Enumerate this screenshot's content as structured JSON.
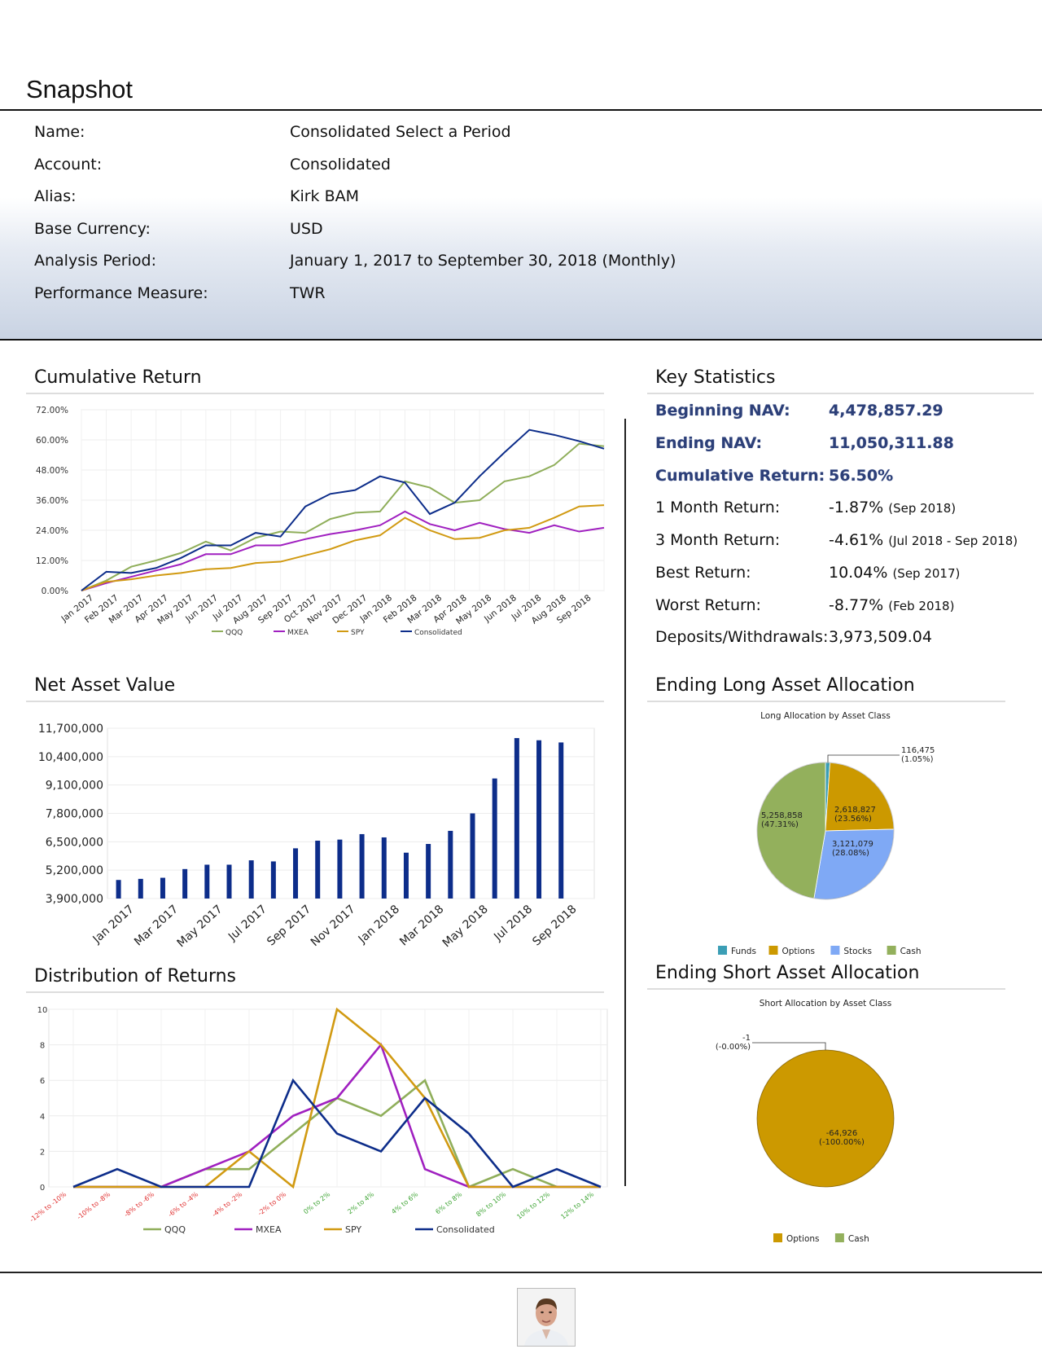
{
  "snapshot": {
    "title": "Snapshot",
    "rows": [
      {
        "label": "Name:",
        "value": "Consolidated Select a Period"
      },
      {
        "label": "Account:",
        "value": "Consolidated"
      },
      {
        "label": "Alias:",
        "value": "Kirk BAM"
      },
      {
        "label": "Base Currency:",
        "value": "USD"
      },
      {
        "label": "Analysis Period:",
        "value": "January 1, 2017 to September 30, 2018 (Monthly)"
      },
      {
        "label": "Performance Measure:",
        "value": "TWR"
      }
    ]
  },
  "sections": {
    "cumulative_return": "Cumulative Return",
    "net_asset_value": "Net Asset Value",
    "distribution_of_returns": "Distribution of Returns",
    "key_statistics": "Key Statistics",
    "ending_long": "Ending Long Asset Allocation",
    "ending_short": "Ending Short Asset Allocation"
  },
  "key_statistics": [
    {
      "label": "Beginning NAV:",
      "value": "4,478,857.29",
      "note": "",
      "highlight": true
    },
    {
      "label": "Ending NAV:",
      "value": "11,050,311.88",
      "note": "",
      "highlight": true
    },
    {
      "label": "Cumulative Return:",
      "value": "56.50%",
      "note": "",
      "highlight": true
    },
    {
      "label": "1 Month Return:",
      "value": "-1.87%",
      "note": "(Sep 2018)",
      "highlight": false
    },
    {
      "label": "3 Month Return:",
      "value": "-4.61%",
      "note": "(Jul 2018 - Sep 2018)",
      "highlight": false
    },
    {
      "label": "Best Return:",
      "value": "10.04%",
      "note": "(Sep 2017)",
      "highlight": false
    },
    {
      "label": "Worst Return:",
      "value": "-8.77%",
      "note": "(Feb 2018)",
      "highlight": false
    },
    {
      "label": "Deposits/Withdrawals:",
      "value": "3,973,509.04",
      "note": "",
      "highlight": false
    }
  ],
  "chart_data": [
    {
      "id": "cumulative",
      "type": "line",
      "x": [
        "Jan 2017",
        "Feb 2017",
        "Mar 2017",
        "Apr 2017",
        "May 2017",
        "Jun 2017",
        "Jul 2017",
        "Aug 2017",
        "Sep 2017",
        "Oct 2017",
        "Nov 2017",
        "Dec 2017",
        "Jan 2018",
        "Feb 2018",
        "Mar 2018",
        "Apr 2018",
        "May 2018",
        "Jun 2018",
        "Jul 2018",
        "Aug 2018",
        "Sep 2018"
      ],
      "ytick_labels": [
        "0.00%",
        "12.00%",
        "24.00%",
        "36.00%",
        "48.00%",
        "60.00%",
        "72.00%"
      ],
      "ylim": [
        0,
        72
      ],
      "series": [
        {
          "name": "QQQ",
          "color": "#8fae5a",
          "values": [
            0,
            4,
            9.5,
            12,
            15,
            19.5,
            16,
            21,
            23.5,
            23,
            28.5,
            31,
            31.5,
            43.5,
            41,
            35,
            36,
            43.5,
            45.5,
            50,
            58.5,
            57.5
          ]
        },
        {
          "name": "MXEA",
          "color": "#a020c0",
          "values": [
            0,
            3,
            5.5,
            8,
            10.5,
            14.5,
            14.5,
            18,
            18,
            20.5,
            22.5,
            24,
            26,
            31.5,
            26.5,
            24,
            27,
            24.5,
            23,
            26,
            23.5,
            25
          ]
        },
        {
          "name": "SPY",
          "color": "#d19a12",
          "values": [
            0,
            3.5,
            4.5,
            6,
            7,
            8.5,
            9,
            11,
            11.5,
            14,
            16.5,
            20,
            22,
            29,
            24,
            20.5,
            21,
            24,
            25,
            29,
            33.5,
            34
          ]
        },
        {
          "name": "Consolidated",
          "color": "#0d2d8a",
          "values": [
            0,
            7.5,
            7,
            9,
            13,
            18,
            18,
            23,
            21.5,
            33.5,
            38.5,
            40,
            45.5,
            43,
            30.5,
            35,
            45.5,
            55,
            64,
            62,
            59.5,
            56.5
          ]
        }
      ]
    },
    {
      "id": "nav",
      "type": "bar",
      "categories": [
        "Jan 2017",
        "Feb 2017",
        "Mar 2017",
        "Apr 2017",
        "May 2017",
        "Jun 2017",
        "Jul 2017",
        "Aug 2017",
        "Sep 2017",
        "Oct 2017",
        "Nov 2017",
        "Dec 2017",
        "Jan 2018",
        "Feb 2018",
        "Mar 2018",
        "Apr 2018",
        "May 2018",
        "Jun 2018",
        "Jul 2018",
        "Aug 2018",
        "Sep 2018",
        "Oct 2018"
      ],
      "xtick_labels": [
        "Jan 2017",
        "Mar 2017",
        "May 2017",
        "Jul 2017",
        "Sep 2017",
        "Nov 2017",
        "Jan 2018",
        "Mar 2018",
        "May 2018",
        "Jul 2018",
        "Sep 2018"
      ],
      "ytick_labels": [
        "3,900,000",
        "5,200,000",
        "6,500,000",
        "7,800,000",
        "9,100,000",
        "10,400,000",
        "11,700,000"
      ],
      "ylim": [
        3900000,
        11700000
      ],
      "color": "#0d2d8a",
      "values": [
        4750000,
        4800000,
        4850000,
        5250000,
        5450000,
        5450000,
        5650000,
        5600000,
        6200000,
        6550000,
        6600000,
        6850000,
        6700000,
        6000000,
        6400000,
        7000000,
        7800000,
        9400000,
        11250000,
        11150000,
        11050000
      ]
    },
    {
      "id": "distribution",
      "type": "line",
      "categories": [
        "-12% to -10%",
        "-10% to -8%",
        "-8% to -6%",
        "-6% to -4%",
        "-4% to -2%",
        "-2% to 0%",
        "0% to 2%",
        "2% to 4%",
        "4% to 6%",
        "6% to 8%",
        "8% to 10%",
        "10% to 12%",
        "12% to 14%"
      ],
      "category_colors": [
        "#e03030",
        "#e03030",
        "#e03030",
        "#e03030",
        "#e03030",
        "#e03030",
        "#3fa535",
        "#3fa535",
        "#3fa535",
        "#3fa535",
        "#3fa535",
        "#3fa535",
        "#3fa535"
      ],
      "ytick_labels": [
        "0",
        "2",
        "4",
        "6",
        "8",
        "10"
      ],
      "ylim": [
        0,
        10
      ],
      "series": [
        {
          "name": "QQQ",
          "color": "#8fae5a",
          "values": [
            0,
            0,
            0,
            1,
            1,
            3,
            5,
            4,
            6,
            0,
            1,
            0,
            0
          ]
        },
        {
          "name": "MXEA",
          "color": "#a020c0",
          "values": [
            0,
            0,
            0,
            1,
            2,
            4,
            5,
            8,
            1,
            0,
            0,
            0,
            0
          ]
        },
        {
          "name": "SPY",
          "color": "#d19a12",
          "values": [
            0,
            0,
            0,
            0,
            2,
            0,
            10,
            8,
            5,
            0,
            0,
            0,
            0
          ]
        },
        {
          "name": "Consolidated",
          "color": "#0d2d8a",
          "values": [
            0,
            1,
            0,
            0,
            0,
            6,
            3,
            2,
            5,
            3,
            0,
            1,
            0
          ]
        }
      ]
    },
    {
      "id": "long_alloc",
      "type": "pie",
      "title": "Long Allocation by Asset Class",
      "slices": [
        {
          "name": "Funds",
          "color": "#3b9eb5",
          "value": 116475,
          "label": "116,475",
          "pct": "(1.05%)"
        },
        {
          "name": "Options",
          "color": "#cc9900",
          "value": 2618827,
          "label": "2,618,827",
          "pct": "(23.56%)"
        },
        {
          "name": "Stocks",
          "color": "#7fa9f5",
          "value": 3121079,
          "label": "3,121,079",
          "pct": "(28.08%)"
        },
        {
          "name": "Cash",
          "color": "#93b05c",
          "value": 5258858,
          "label": "5,258,858",
          "pct": "(47.31%)"
        }
      ],
      "legend": [
        "Funds",
        "Options",
        "Stocks",
        "Cash"
      ]
    },
    {
      "id": "short_alloc",
      "type": "pie",
      "title": "Short Allocation by Asset Class",
      "slices": [
        {
          "name": "Options",
          "color": "#cc9900",
          "value": 64926,
          "label": "-64,926",
          "pct": "(-100.00%)"
        },
        {
          "name": "Cash",
          "color": "#93b05c",
          "value": 1,
          "label": "-1",
          "pct": "(-0.00%)"
        }
      ],
      "legend": [
        "Options",
        "Cash"
      ]
    }
  ],
  "footer": {
    "photo": "profile-photo"
  }
}
